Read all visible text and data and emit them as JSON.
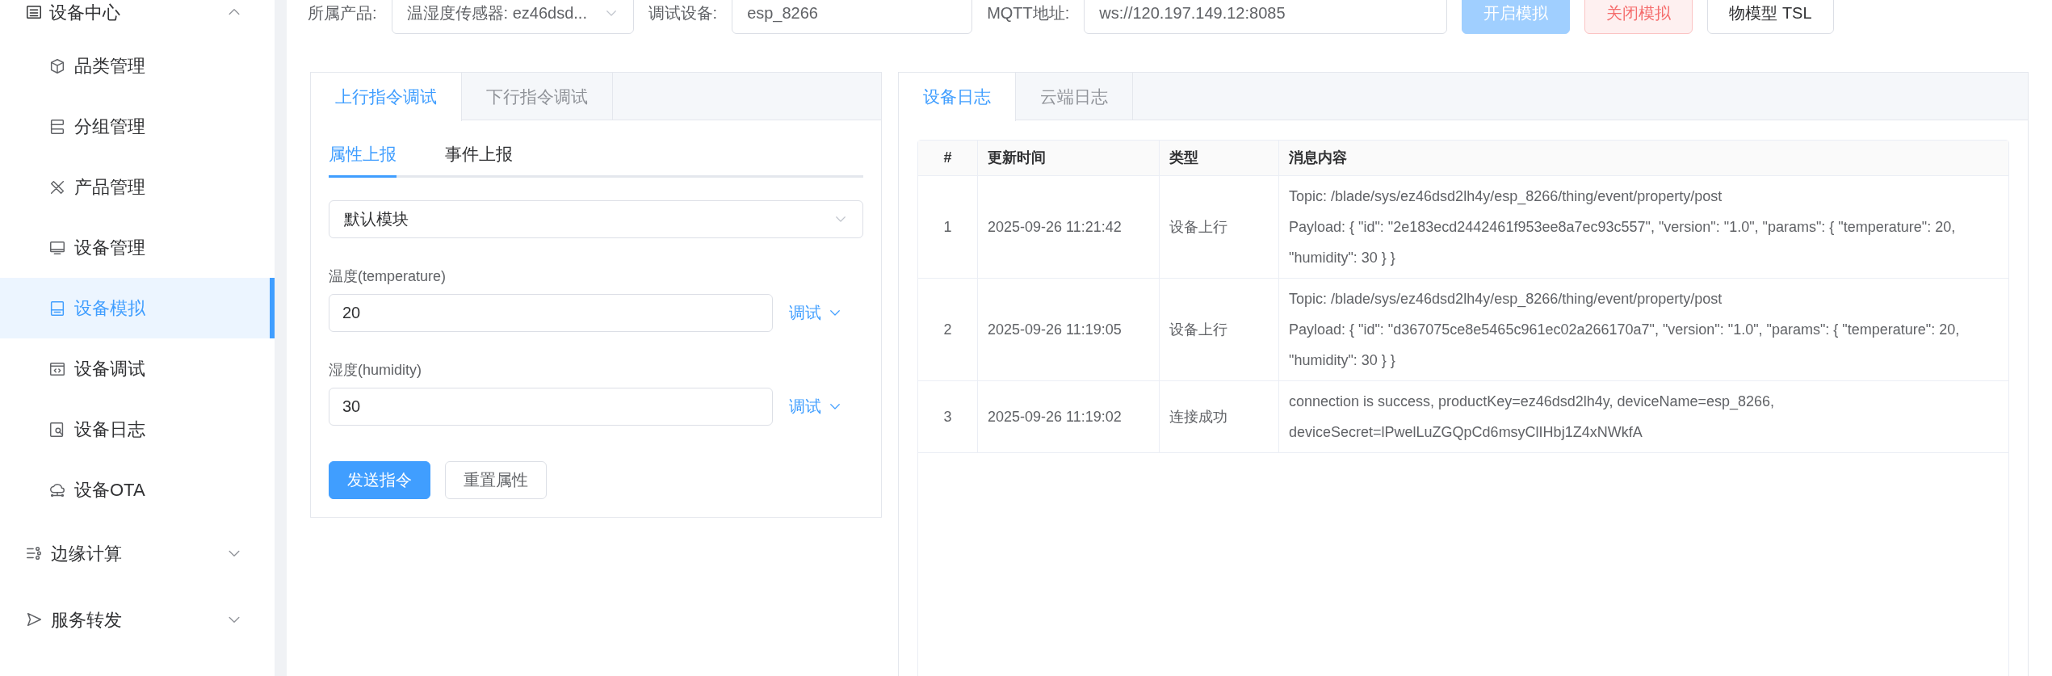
{
  "sidebar": {
    "group": {
      "label": "设备中心",
      "expanded": true,
      "items": [
        {
          "label": "品类管理",
          "selected": false
        },
        {
          "label": "分组管理",
          "selected": false
        },
        {
          "label": "产品管理",
          "selected": false
        },
        {
          "label": "设备管理",
          "selected": false
        },
        {
          "label": "设备模拟",
          "selected": true
        },
        {
          "label": "设备调试",
          "selected": false
        },
        {
          "label": "设备日志",
          "selected": false
        },
        {
          "label": "设备OTA",
          "selected": false
        }
      ]
    },
    "others": [
      {
        "label": "边缘计算",
        "expanded": false
      },
      {
        "label": "服务转发",
        "expanded": false
      }
    ]
  },
  "toolbar": {
    "fields": [
      {
        "label": "所属产品:",
        "kind": "select",
        "value": "温湿度传感器: ez46dsd..."
      },
      {
        "label": "调试设备:",
        "kind": "input",
        "value": "esp_8266"
      },
      {
        "label": "MQTT地址:",
        "kind": "input",
        "value": "ws://120.197.149.12:8085"
      }
    ],
    "buttons": [
      {
        "label": "开启模拟",
        "kind": "primary",
        "disabled": true
      },
      {
        "label": "关闭模拟",
        "kind": "danger",
        "disabled": false
      },
      {
        "label": "物模型 TSL",
        "kind": "default",
        "disabled": false
      }
    ]
  },
  "command_panel": {
    "tabs": [
      {
        "label": "上行指令调试",
        "selected": true
      },
      {
        "label": "下行指令调试",
        "selected": false
      }
    ],
    "subtabs": [
      {
        "label": "属性上报",
        "selected": true
      },
      {
        "label": "事件上报",
        "selected": false
      }
    ],
    "module_select": {
      "value": "默认模块"
    },
    "properties": [
      {
        "label": "温度(temperature)",
        "value": "20",
        "action": "调试"
      },
      {
        "label": "湿度(humidity)",
        "value": "30",
        "action": "调试"
      }
    ],
    "buttons": [
      {
        "label": "发送指令",
        "kind": "primary"
      },
      {
        "label": "重置属性",
        "kind": "default"
      }
    ]
  },
  "log_panel": {
    "tabs": [
      {
        "label": "设备日志",
        "selected": true
      },
      {
        "label": "云端日志",
        "selected": false
      }
    ],
    "table": {
      "columns": [
        "#",
        "更新时间",
        "类型",
        "消息内容"
      ],
      "rows": [
        {
          "index": "1",
          "time": "2025-09-26 11:21:42",
          "type": "设备上行",
          "message": [
            "Topic: /blade/sys/ez46dsd2lh4y/esp_8266/thing/event/property/post",
            "Payload: { \"id\": \"2e183ecd2442461f953ee8a7ec93c557\", \"version\": \"1.0\", \"params\": { \"temperature\": 20, \"humidity\": 30 } }"
          ]
        },
        {
          "index": "2",
          "time": "2025-09-26 11:19:05",
          "type": "设备上行",
          "message": [
            "Topic: /blade/sys/ez46dsd2lh4y/esp_8266/thing/event/property/post",
            "Payload: { \"id\": \"d367075ce8e5465c961ec02a266170a7\", \"version\": \"1.0\", \"params\": { \"temperature\": 20, \"humidity\": 30 } }"
          ]
        },
        {
          "index": "3",
          "time": "2025-09-26 11:19:02",
          "type": "连接成功",
          "message": [
            "connection is success, productKey=ez46dsd2lh4y, deviceName=esp_8266, deviceSecret=lPwelLuZGQpCd6msyClIHbj1Z4xNWkfA"
          ]
        }
      ]
    }
  }
}
